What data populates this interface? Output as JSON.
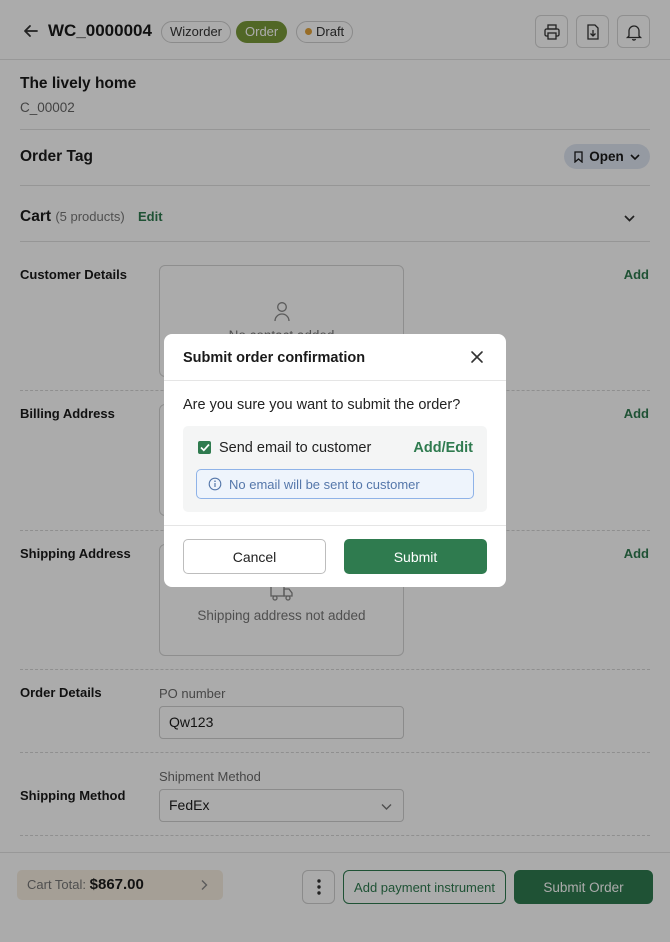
{
  "header": {
    "title": "WC_0000004",
    "tags": [
      "Wizorder",
      "Order",
      "Draft"
    ],
    "icons": [
      "back-arrow-icon",
      "printer-icon",
      "download-file-icon",
      "bell-icon"
    ]
  },
  "customer": {
    "name": "The lively home",
    "code": "C_00002"
  },
  "order_tag": {
    "label": "Order Tag",
    "status": "Open"
  },
  "cart": {
    "label": "Cart",
    "count": "(5 products)",
    "edit": "Edit"
  },
  "customer_details": {
    "label": "Customer Details",
    "add": "Add",
    "empty_text": "No contact added"
  },
  "billing": {
    "label": "Billing Address",
    "add": "Add"
  },
  "shipping": {
    "label": "Shipping Address",
    "add": "Add",
    "empty_text": "Shipping address not added"
  },
  "order_details": {
    "label": "Order Details",
    "po_label": "PO number",
    "po_value": "Qw123"
  },
  "shipping_method": {
    "label": "Shipping Method",
    "field_label": "Shipment Method",
    "value": "FedEx"
  },
  "footer": {
    "cart_total_label": "Cart Total:",
    "cart_total_value": "$867.00",
    "add_payment": "Add payment instrument",
    "submit_order": "Submit Order"
  },
  "modal": {
    "title": "Submit order confirmation",
    "question": "Are you sure you want to submit the order?",
    "checkbox_label": "Send email to customer",
    "checkbox_checked": true,
    "add_edit": "Add/Edit",
    "info_text": "No email will be sent to customer",
    "cancel": "Cancel",
    "submit": "Submit"
  },
  "colors": {
    "accent": "#2f7b4f",
    "order_pill": "#7a9a3a",
    "draft_dot": "#e3a33b",
    "info": "#8fb3e8"
  }
}
